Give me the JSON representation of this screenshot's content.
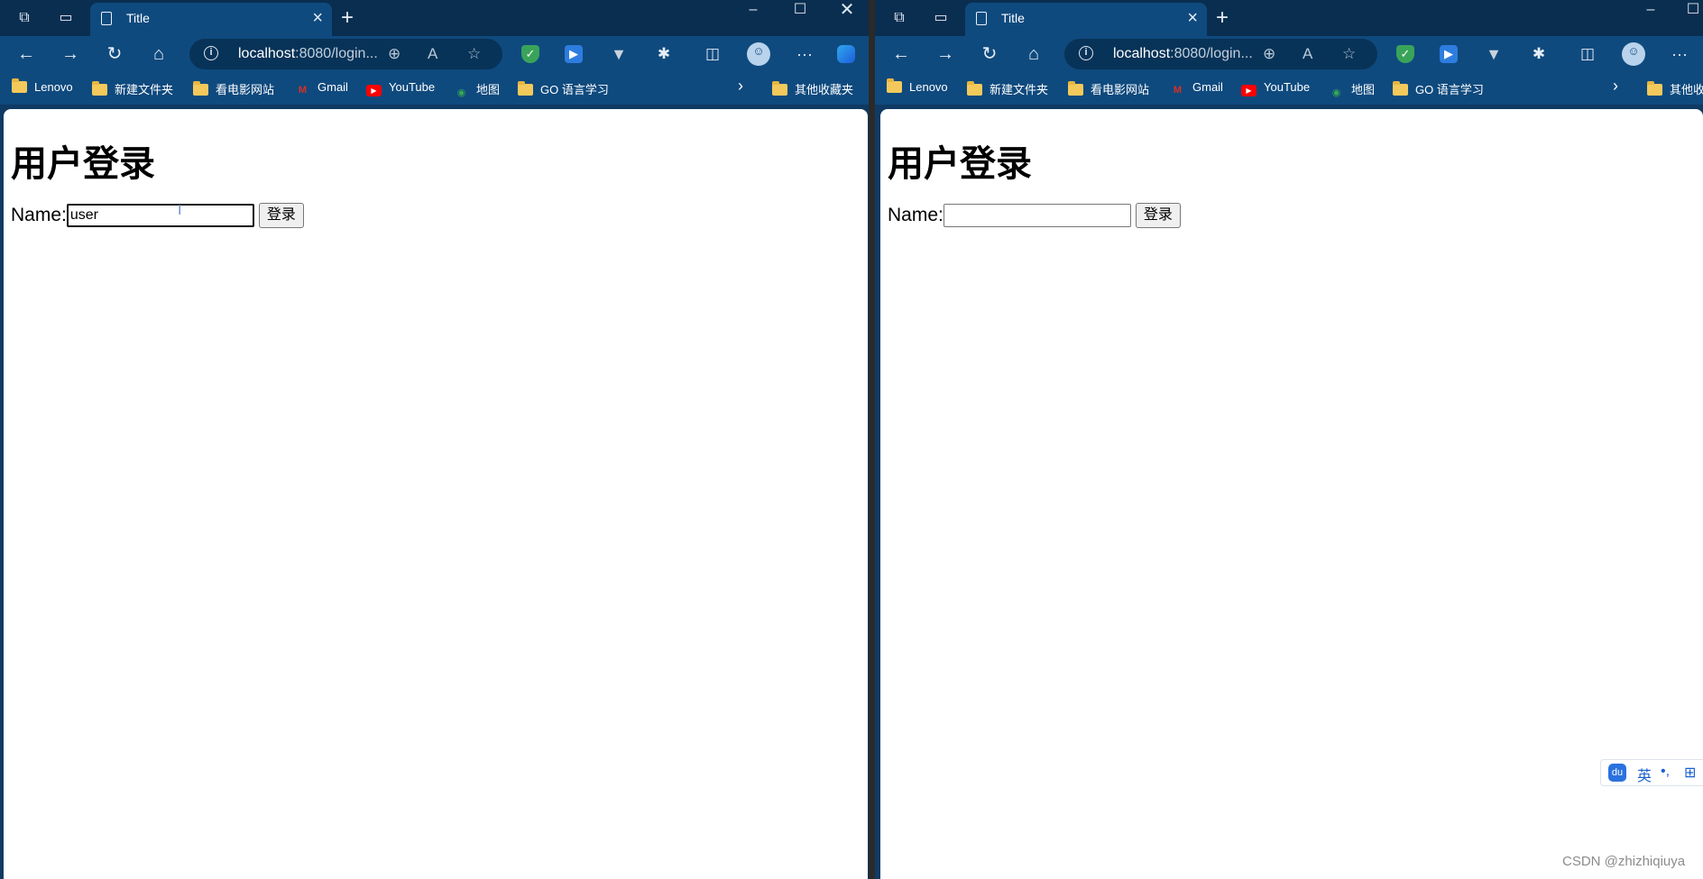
{
  "browser": {
    "tab_title": "Title",
    "url_host": "localhost",
    "url_rest": ":8080/login...",
    "bookmarks": [
      {
        "label": "Lenovo",
        "icon": "folder-icon"
      },
      {
        "label": "新建文件夹",
        "icon": "folder-icon"
      },
      {
        "label": "看电影网站",
        "icon": "folder-icon"
      },
      {
        "label": "Gmail",
        "icon": "gmail-icon"
      },
      {
        "label": "YouTube",
        "icon": "youtube-icon"
      },
      {
        "label": "地图",
        "icon": "maps-icon"
      },
      {
        "label": "GO 语言学习",
        "icon": "folder-icon"
      }
    ],
    "other_bookmarks_left": "其他收藏夹",
    "other_bookmarks_right": "其他收",
    "colors": {
      "frame": "#0f4a7e",
      "titlebar": "#0a2e50",
      "folder": "#f4c95b"
    }
  },
  "page": {
    "heading": "用户登录",
    "name_label": "Name:",
    "login_button": "登录"
  },
  "left_window": {
    "name_value": "user"
  },
  "right_window": {
    "name_value": ""
  },
  "ime": {
    "lang": "英",
    "punct": "•,"
  },
  "watermark": "CSDN @zhizhiqiuya"
}
